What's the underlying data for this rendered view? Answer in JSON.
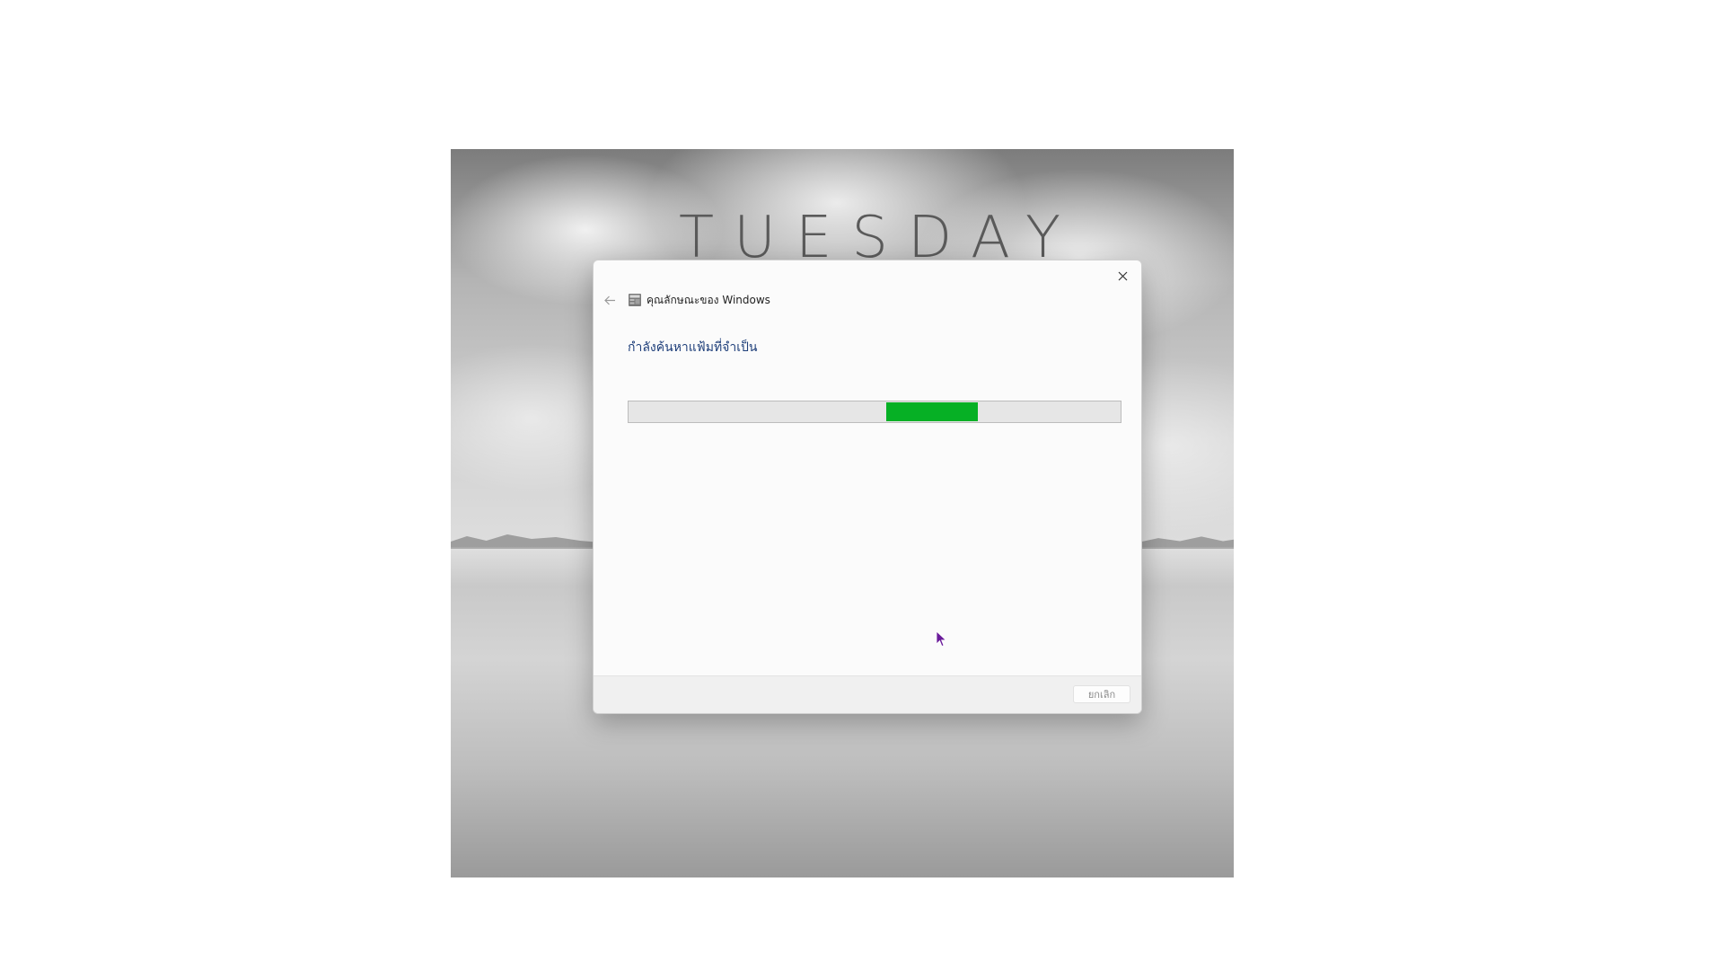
{
  "wallpaper": {
    "brand_text": "TUESDAY"
  },
  "dialog": {
    "app_title": "คุณลักษณะของ Windows",
    "heading": "กำลังค้นหาแฟ้มที่จำเป็น",
    "progress": {
      "indeterminate": true,
      "fill_start_fraction": 0.523,
      "fill_end_fraction": 0.71,
      "fill_color": "#06b025"
    },
    "cancel_label": "ยกเลิก"
  },
  "icons": {
    "close": "close-icon",
    "back": "back-arrow-icon",
    "app": "windows-features-icon",
    "cursor": "mouse-pointer-icon"
  },
  "colors": {
    "heading": "#1f3f7a",
    "cursor": "#6a1b9a"
  }
}
